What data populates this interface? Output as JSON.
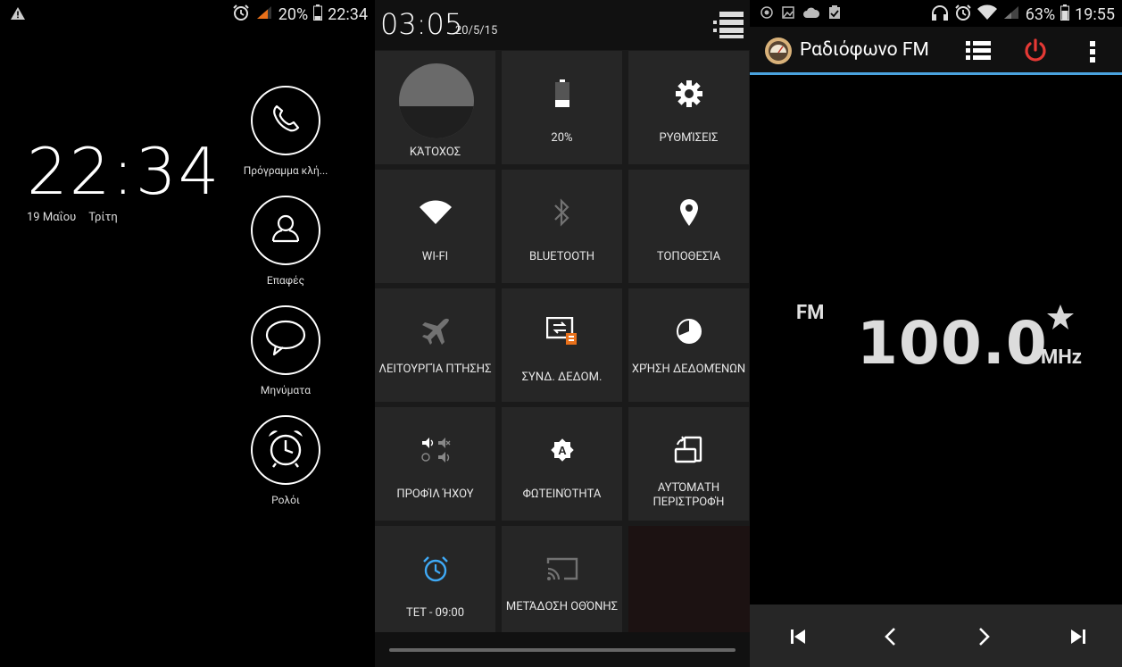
{
  "lock_screen": {
    "status_time": "22:34",
    "battery": "20%",
    "clock": "22:34",
    "date": "19 Μαΐου",
    "weekday": "Τρίτη",
    "shortcuts": [
      {
        "label": "Πρόγραμμα κλή..."
      },
      {
        "label": "Επαφές"
      },
      {
        "label": "Μηνύματα"
      },
      {
        "label": "Ρολόι"
      }
    ]
  },
  "quick_settings": {
    "time": "03:05",
    "date": "20/5/15",
    "tiles": [
      {
        "label": "ΚΆΤΟΧΟΣ"
      },
      {
        "label": "20%"
      },
      {
        "label": "ΡΥΘΜΊΣΕΙΣ"
      },
      {
        "label": "WI-FI"
      },
      {
        "label": "BLUETOOTH"
      },
      {
        "label": "ΤΟΠΟΘΕΣΊΑ"
      },
      {
        "label": "ΛΕΙΤΟΥΡΓΊΑ ΠΤΉΣΗΣ"
      },
      {
        "label": "ΣΥΝΔ. ΔΕΔΟΜ."
      },
      {
        "label": "ΧΡΉΣΗ ΔΕΔΟΜΈΝΩΝ"
      },
      {
        "label": "ΠΡΟΦΊΛ ΉΧΟΥ"
      },
      {
        "label": "ΦΩΤΕΙΝΌΤΗΤΑ"
      },
      {
        "label": "ΑΥΤΌΜΑΤΗ ΠΕΡΙΣΤΡΟΦΉ"
      },
      {
        "label": "ΤΕΤ - 09:00"
      },
      {
        "label": "ΜΕΤΆΔΟΣΗ ΟΘΌΝΗΣ"
      }
    ]
  },
  "fm_radio": {
    "status_time": "19:55",
    "battery": "63%",
    "title": "Ραδιόφωνο FM",
    "band": "FM",
    "frequency": "100.0",
    "unit": "MHz",
    "colors": {
      "accent": "#4aa3df",
      "power": "#e53935"
    }
  }
}
